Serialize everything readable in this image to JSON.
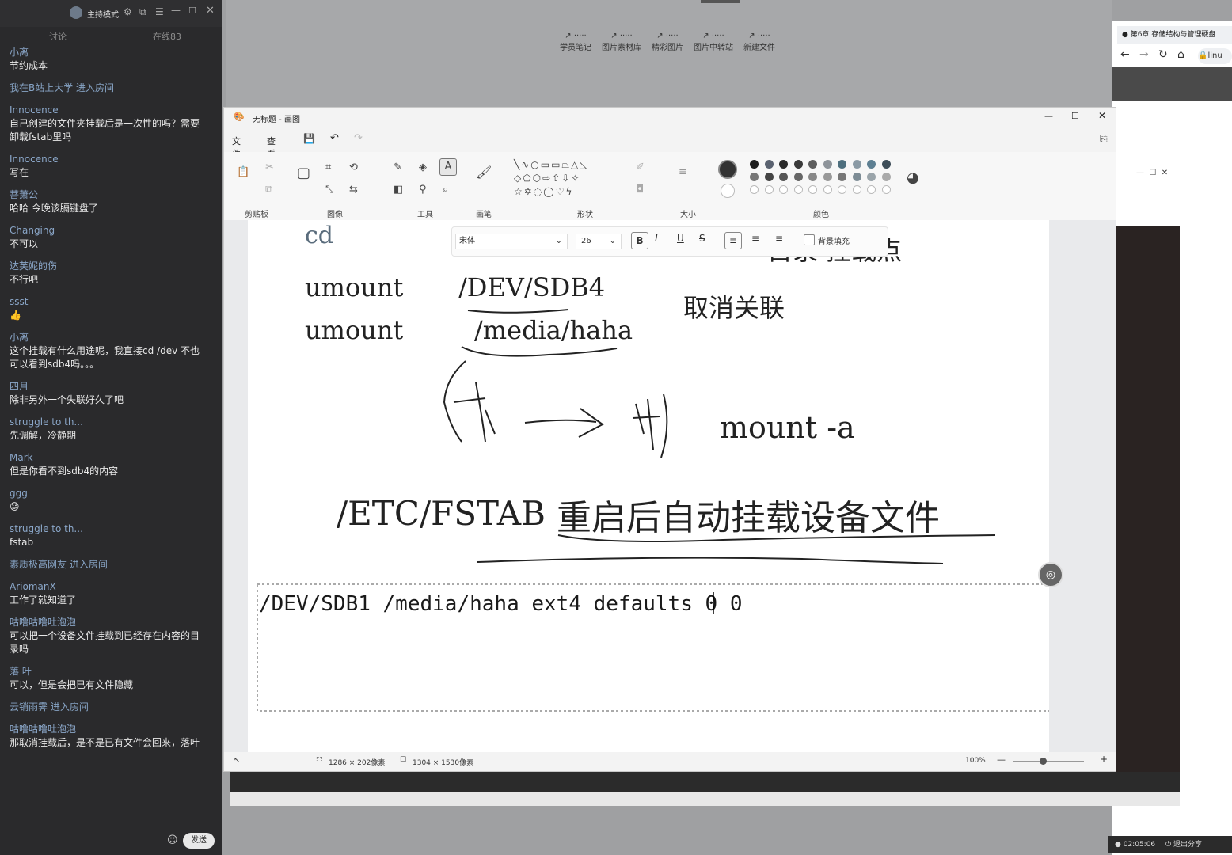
{
  "chat": {
    "host_mode": "主持模式",
    "tab_discuss": "讨论",
    "tab_online": "在线83",
    "send_label": "发送",
    "messages": [
      {
        "user": "小离",
        "text": "节约成本"
      },
      {
        "system": "我在B站上大学 进入房间"
      },
      {
        "user": "Innocence",
        "text": "自己创建的文件夹挂载后是一次性的吗？需要卸载fstab里吗"
      },
      {
        "user": "Innocence",
        "text": "写在"
      },
      {
        "user": "菩萧公",
        "text": "哈哈 今晚该膈键盘了"
      },
      {
        "user": "Changing",
        "text": "不可以"
      },
      {
        "user": "达芙妮的伤",
        "text": "不行吧"
      },
      {
        "user": "ssst",
        "text": "👍"
      },
      {
        "user": "小离",
        "text": "这个挂载有什么用途呢，我直接cd /dev 不也可以看到sdb4吗。。。"
      },
      {
        "user": "四月",
        "text": "除非另外一个失联好久了吧"
      },
      {
        "user": "struggle to th...",
        "text": "先调解，冷静期"
      },
      {
        "user": "Mark",
        "text": "但是你看不到sdb4的内容"
      },
      {
        "user": "ggg",
        "text": "😟"
      },
      {
        "user": "struggle to th...",
        "text": "fstab"
      },
      {
        "system": "素质极高网友 进入房间"
      },
      {
        "user": "AriomanX",
        "text": "工作了就知道了"
      },
      {
        "user": "咕噜咕噜吐泡泡",
        "text": "可以把一个设备文件挂载到已经存在内容的目录吗"
      },
      {
        "user": "落 叶",
        "text": "可以，但是会把已有文件隐藏"
      },
      {
        "system": "云销雨霁 进入房间"
      },
      {
        "user": "咕噜咕噜吐泡泡",
        "text": "那取消挂载后，是不是已有文件会回来，落叶"
      }
    ]
  },
  "topstrip": {
    "buttons": [
      "学员笔记",
      "图片素材库",
      "精彩图片",
      "图片中转站",
      "新建文件"
    ]
  },
  "browser": {
    "tab_title": "第6章 存储结构与管理硬盘 |",
    "url_snippet": "linu"
  },
  "paint": {
    "title": "无标题 - 画图",
    "menu": [
      "文件",
      "查看"
    ],
    "groups": [
      "剪贴板",
      "图像",
      "工具",
      "画笔",
      "形状",
      "大小",
      "颜色"
    ],
    "font_name": "宋体",
    "font_size": "26",
    "bg_fill_label": "背景填充",
    "status_selection": "1286 × 202像素",
    "status_canvas": "1304 × 1530像素",
    "zoom": "100%"
  },
  "canvas_text": {
    "cd": "cd",
    "mount_point_partial": "目录  挂载点",
    "umount1_cmd": "umount",
    "umount1_arg": "/DEV/SDB4",
    "umount2_cmd": "umount",
    "umount2_arg": "/media/haha",
    "cancel_assoc": "取消关联",
    "mount_a": "mount -a",
    "etc_fstab": "/ETC/FSTAB",
    "reboot_mount": "重启后自动挂载设备文件",
    "fstab_line": "/DEV/SDB1 /media/haha ext4 defaults 0 0"
  },
  "taskbar": {
    "time": "02:05:06",
    "exit_share": "退出分享"
  },
  "palette": [
    "#1d1d1d",
    "#5a6270",
    "#2a2a2a",
    "#3a3a3a",
    "#5d5d5d",
    "#8e949a",
    "#4e6f7e",
    "#8a9aa5",
    "#5d7f92",
    "#3d4d58",
    "#777777",
    "#444444",
    "#555555",
    "#666666",
    "#888888",
    "#999999",
    "#777777",
    "#7d8c95",
    "#9aa4aa",
    "#aaaaaa"
  ]
}
